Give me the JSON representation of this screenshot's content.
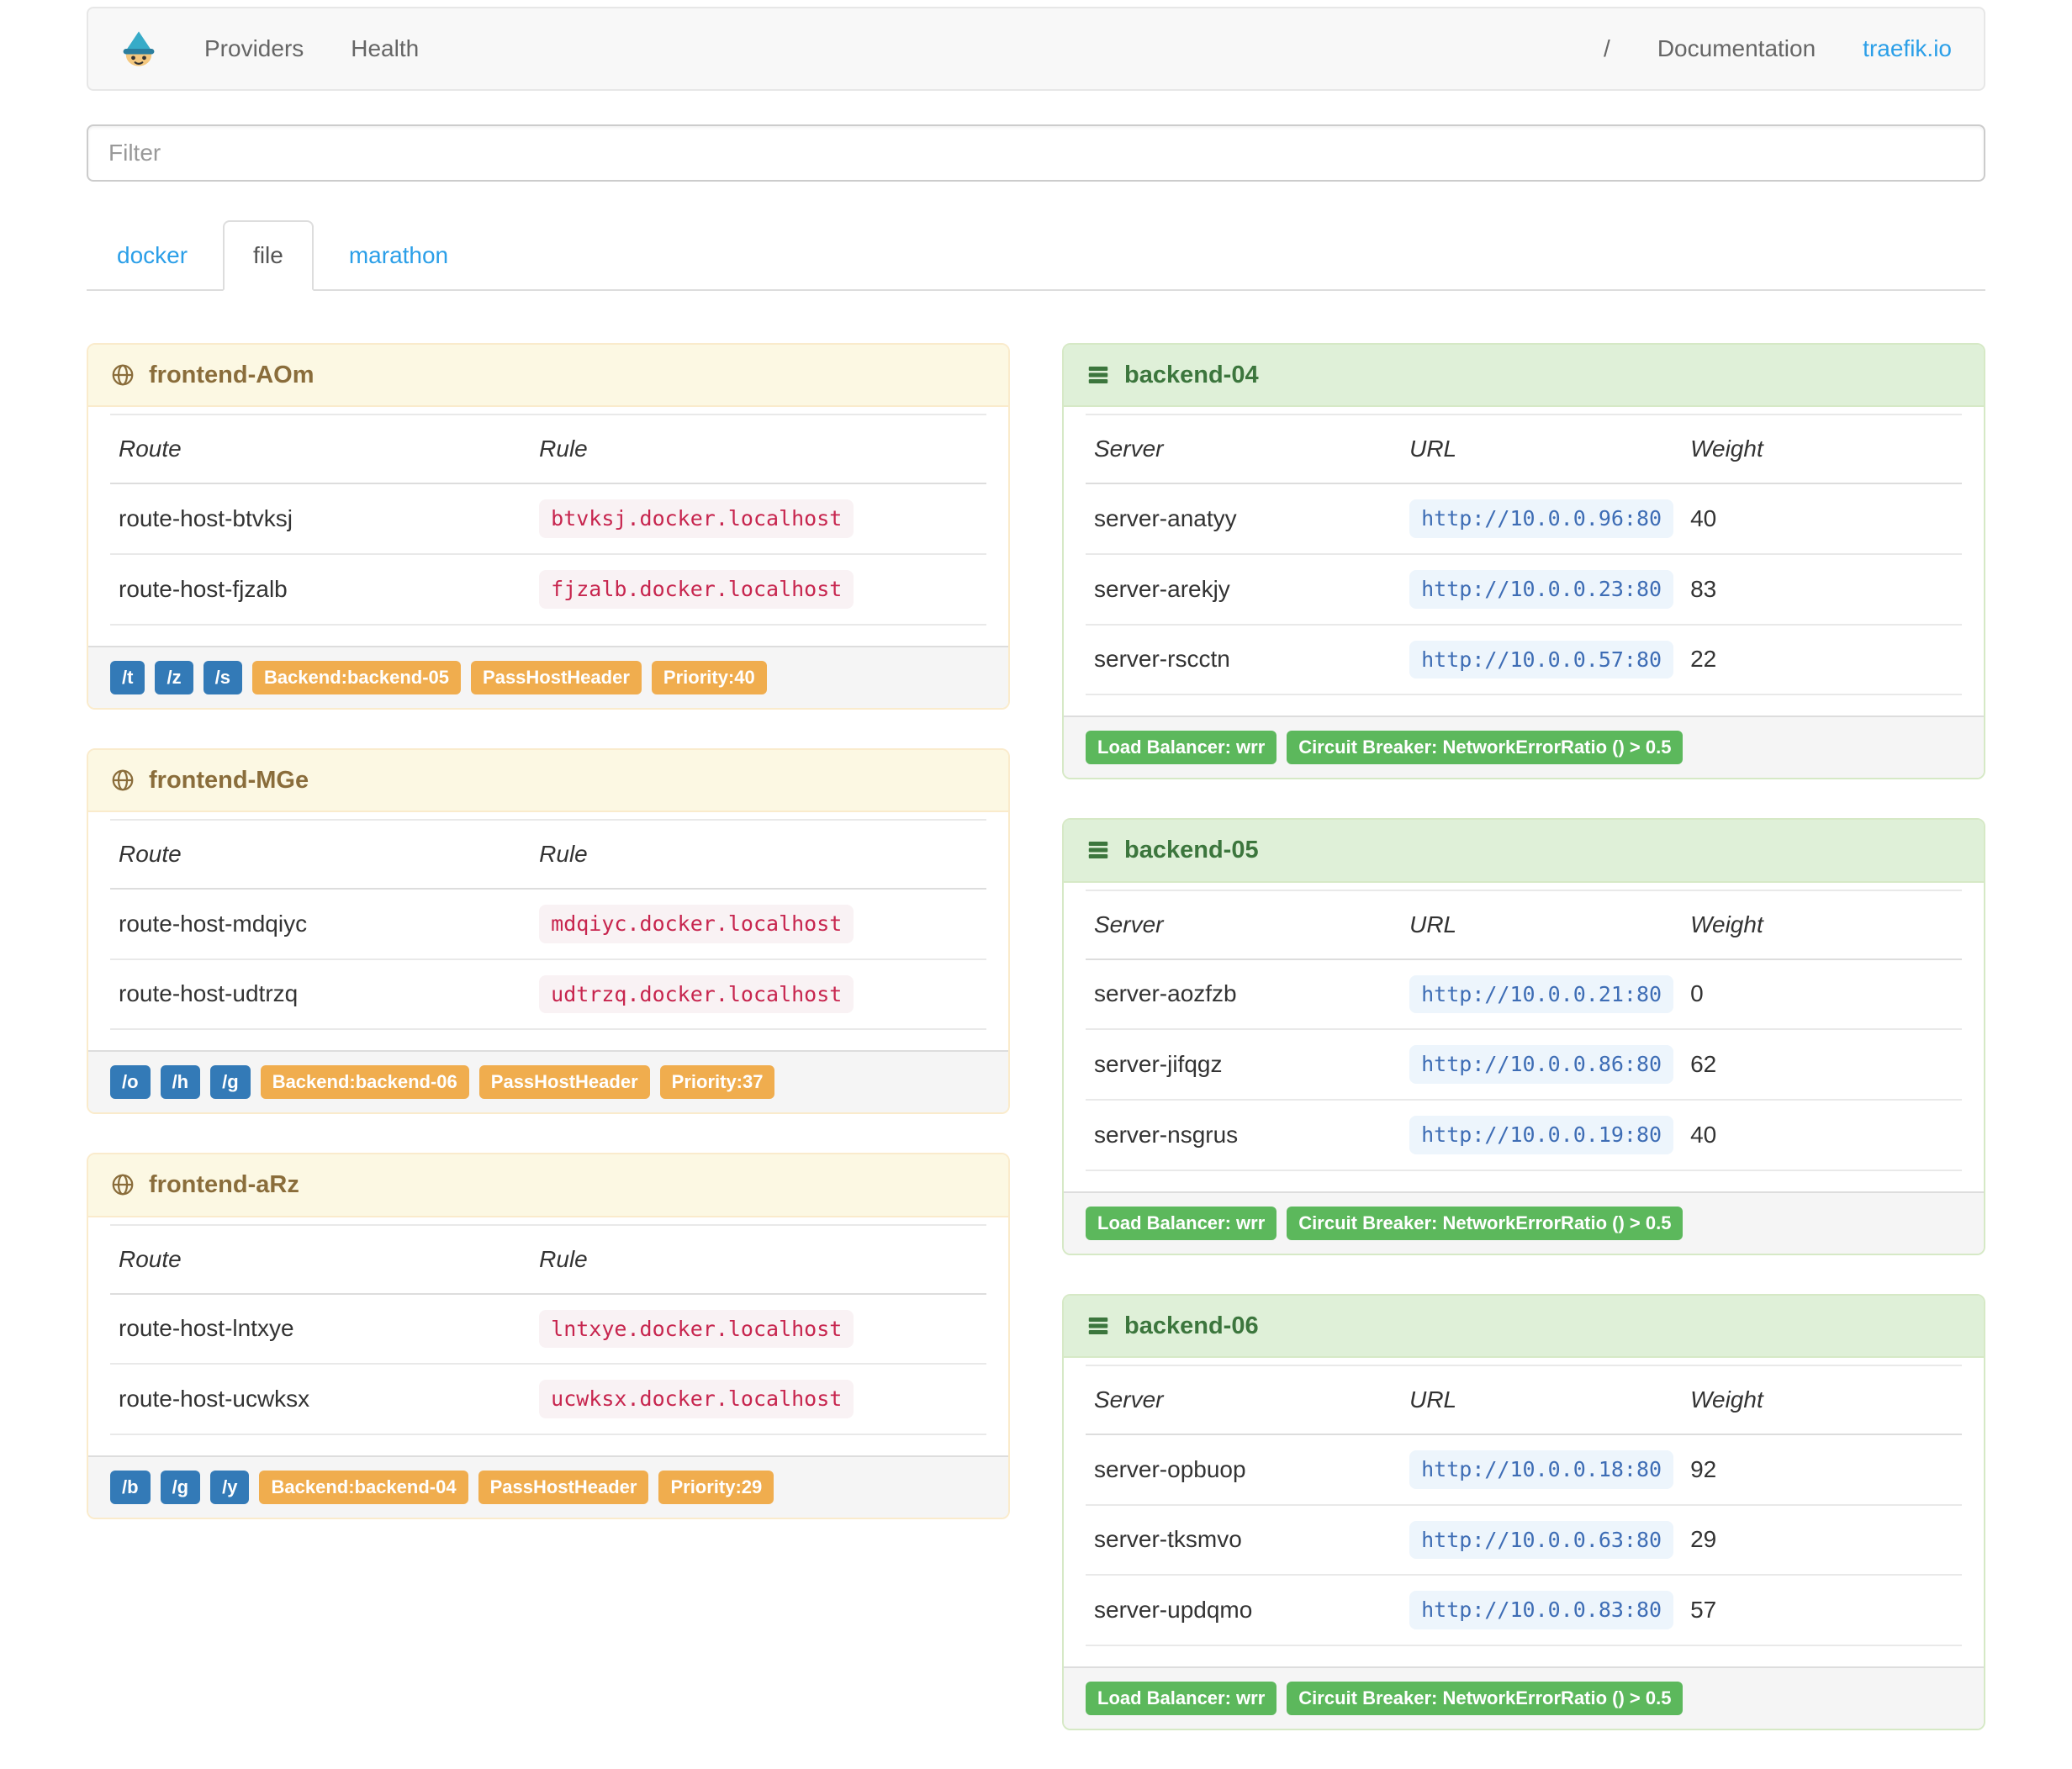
{
  "navbar": {
    "links": [
      {
        "label": "Providers"
      },
      {
        "label": "Health"
      }
    ],
    "right": {
      "separator": "/",
      "documentation": "Documentation",
      "site": "traefik.io"
    }
  },
  "filter": {
    "placeholder": "Filter"
  },
  "tabs": [
    {
      "label": "docker",
      "active": false
    },
    {
      "label": "file",
      "active": true
    },
    {
      "label": "marathon",
      "active": false
    }
  ],
  "frontends": [
    {
      "name": "frontend-AOm",
      "columns": [
        "Route",
        "Rule"
      ],
      "routes": [
        {
          "route": "route-host-btvksj",
          "rule": "btvksj.docker.localhost"
        },
        {
          "route": "route-host-fjzalb",
          "rule": "fjzalb.docker.localhost"
        }
      ],
      "badges": {
        "paths": [
          "/t",
          "/z",
          "/s"
        ],
        "tags": [
          "Backend:backend-05",
          "PassHostHeader",
          "Priority:40"
        ]
      }
    },
    {
      "name": "frontend-MGe",
      "columns": [
        "Route",
        "Rule"
      ],
      "routes": [
        {
          "route": "route-host-mdqiyc",
          "rule": "mdqiyc.docker.localhost"
        },
        {
          "route": "route-host-udtrzq",
          "rule": "udtrzq.docker.localhost"
        }
      ],
      "badges": {
        "paths": [
          "/o",
          "/h",
          "/g"
        ],
        "tags": [
          "Backend:backend-06",
          "PassHostHeader",
          "Priority:37"
        ]
      }
    },
    {
      "name": "frontend-aRz",
      "columns": [
        "Route",
        "Rule"
      ],
      "routes": [
        {
          "route": "route-host-lntxye",
          "rule": "lntxye.docker.localhost"
        },
        {
          "route": "route-host-ucwksx",
          "rule": "ucwksx.docker.localhost"
        }
      ],
      "badges": {
        "paths": [
          "/b",
          "/g",
          "/y"
        ],
        "tags": [
          "Backend:backend-04",
          "PassHostHeader",
          "Priority:29"
        ]
      }
    }
  ],
  "backends": [
    {
      "name": "backend-04",
      "columns": [
        "Server",
        "URL",
        "Weight"
      ],
      "servers": [
        {
          "server": "server-anatyy",
          "url": "http://10.0.0.96:80",
          "weight": "40"
        },
        {
          "server": "server-arekjy",
          "url": "http://10.0.0.23:80",
          "weight": "83"
        },
        {
          "server": "server-rscctn",
          "url": "http://10.0.0.57:80",
          "weight": "22"
        }
      ],
      "badges": [
        "Load Balancer: wrr",
        "Circuit Breaker: NetworkErrorRatio () > 0.5"
      ]
    },
    {
      "name": "backend-05",
      "columns": [
        "Server",
        "URL",
        "Weight"
      ],
      "servers": [
        {
          "server": "server-aozfzb",
          "url": "http://10.0.0.21:80",
          "weight": "0"
        },
        {
          "server": "server-jifqgz",
          "url": "http://10.0.0.86:80",
          "weight": "62"
        },
        {
          "server": "server-nsgrus",
          "url": "http://10.0.0.19:80",
          "weight": "40"
        }
      ],
      "badges": [
        "Load Balancer: wrr",
        "Circuit Breaker: NetworkErrorRatio () > 0.5"
      ]
    },
    {
      "name": "backend-06",
      "columns": [
        "Server",
        "URL",
        "Weight"
      ],
      "servers": [
        {
          "server": "server-opbuop",
          "url": "http://10.0.0.18:80",
          "weight": "92"
        },
        {
          "server": "server-tksmvo",
          "url": "http://10.0.0.63:80",
          "weight": "29"
        },
        {
          "server": "server-updqmo",
          "url": "http://10.0.0.83:80",
          "weight": "57"
        }
      ],
      "badges": [
        "Load Balancer: wrr",
        "Circuit Breaker: NetworkErrorRatio () > 0.5"
      ]
    }
  ],
  "colors": {
    "link_blue": "#2b9fe8",
    "badge_blue": "#337ab7",
    "badge_orange": "#f0ad4e",
    "badge_green": "#5cb85c",
    "frontend_header_bg": "#fcf8e3",
    "frontend_header_text": "#8a6d3b",
    "backend_header_bg": "#dff0d8",
    "backend_header_text": "#3c763d",
    "rule_chip_text": "#c7254e",
    "rule_chip_bg": "#f9f2f4",
    "url_chip_text": "#3e6db5",
    "navbar_bg": "#f8f8f8"
  }
}
